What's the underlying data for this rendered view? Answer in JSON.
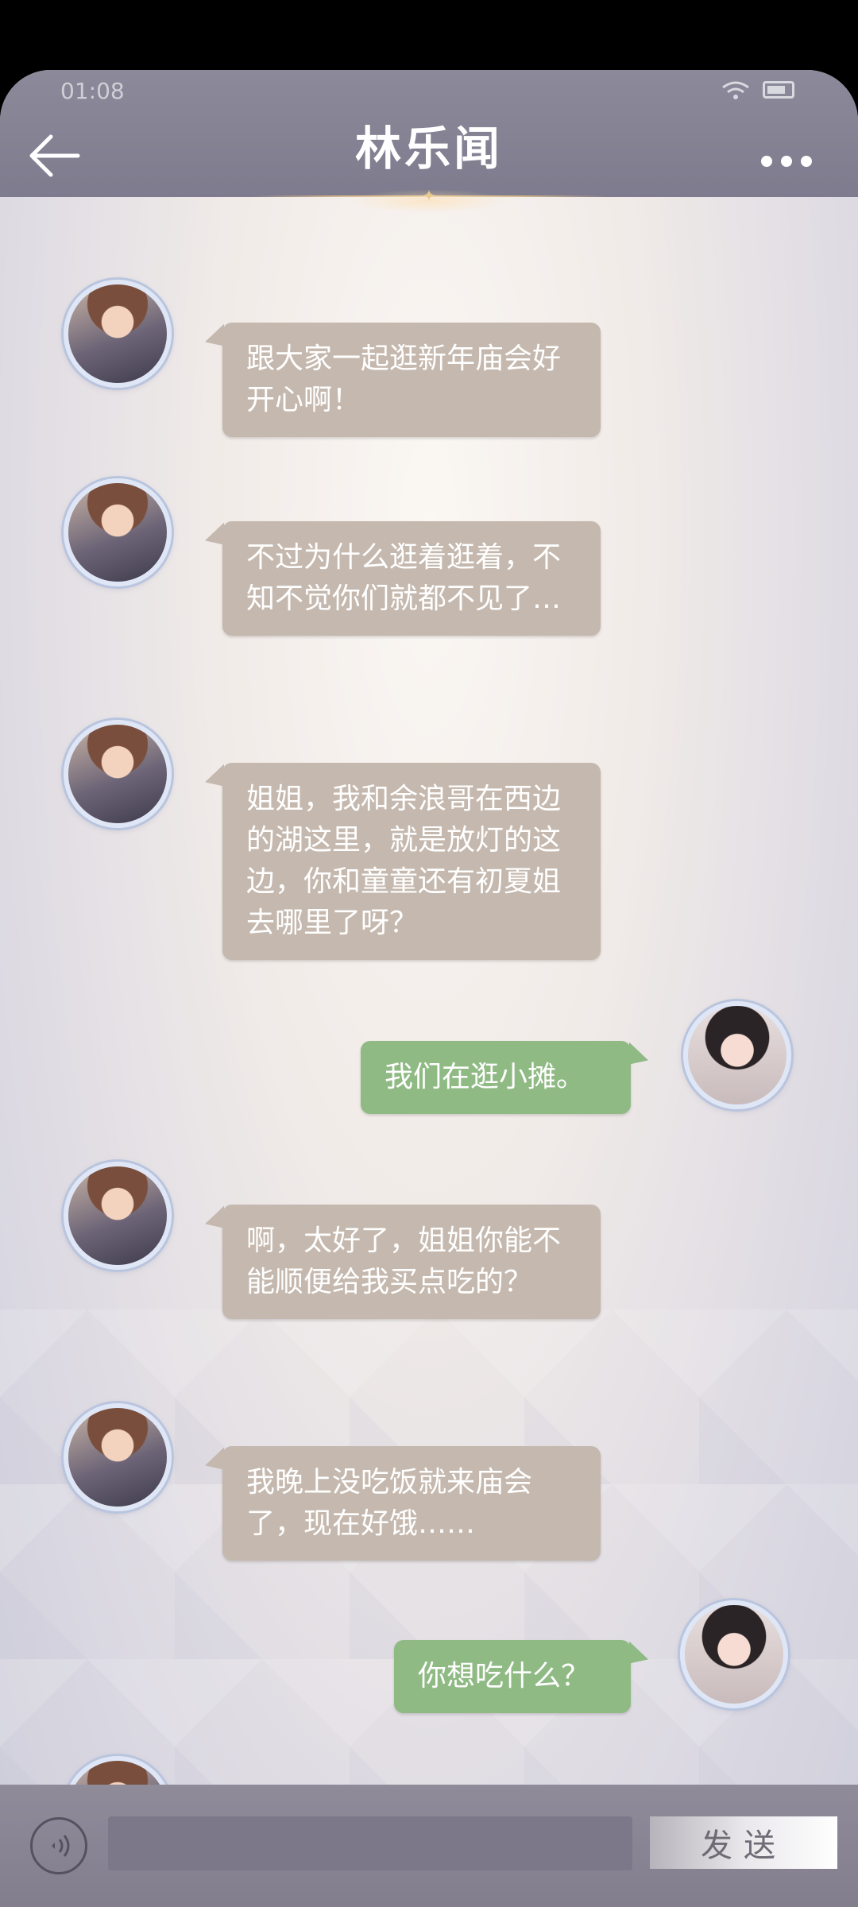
{
  "status_bar": {
    "time": "01:08"
  },
  "header": {
    "title": "林乐闻"
  },
  "messages": [
    {
      "side": "in",
      "text": "跟大家一起逛新年庙会好开心啊！"
    },
    {
      "side": "in",
      "text": "不过为什么逛着逛着，不知不觉你们就都不见了…"
    },
    {
      "side": "in",
      "text": "姐姐，我和余浪哥在西边的湖这里，就是放灯的这边，你和童童还有初夏姐去哪里了呀？"
    },
    {
      "side": "out",
      "text": "我们在逛小摊。"
    },
    {
      "side": "in",
      "text": "啊，太好了，姐姐你能不能顺便给我买点吃的？"
    },
    {
      "side": "in",
      "text": "我晚上没吃饭就来庙会了，现在好饿……"
    },
    {
      "side": "out",
      "text": "你想吃什么？"
    }
  ],
  "footer": {
    "send_label": "发送",
    "input_value": ""
  },
  "icons": {
    "back": "back-arrow-icon",
    "more": "more-dots-icon",
    "voice": "voice-icon"
  },
  "colors": {
    "incoming_bubble": "#c5b8ae",
    "outgoing_bubble": "#8fba84",
    "header": "#827f90"
  }
}
